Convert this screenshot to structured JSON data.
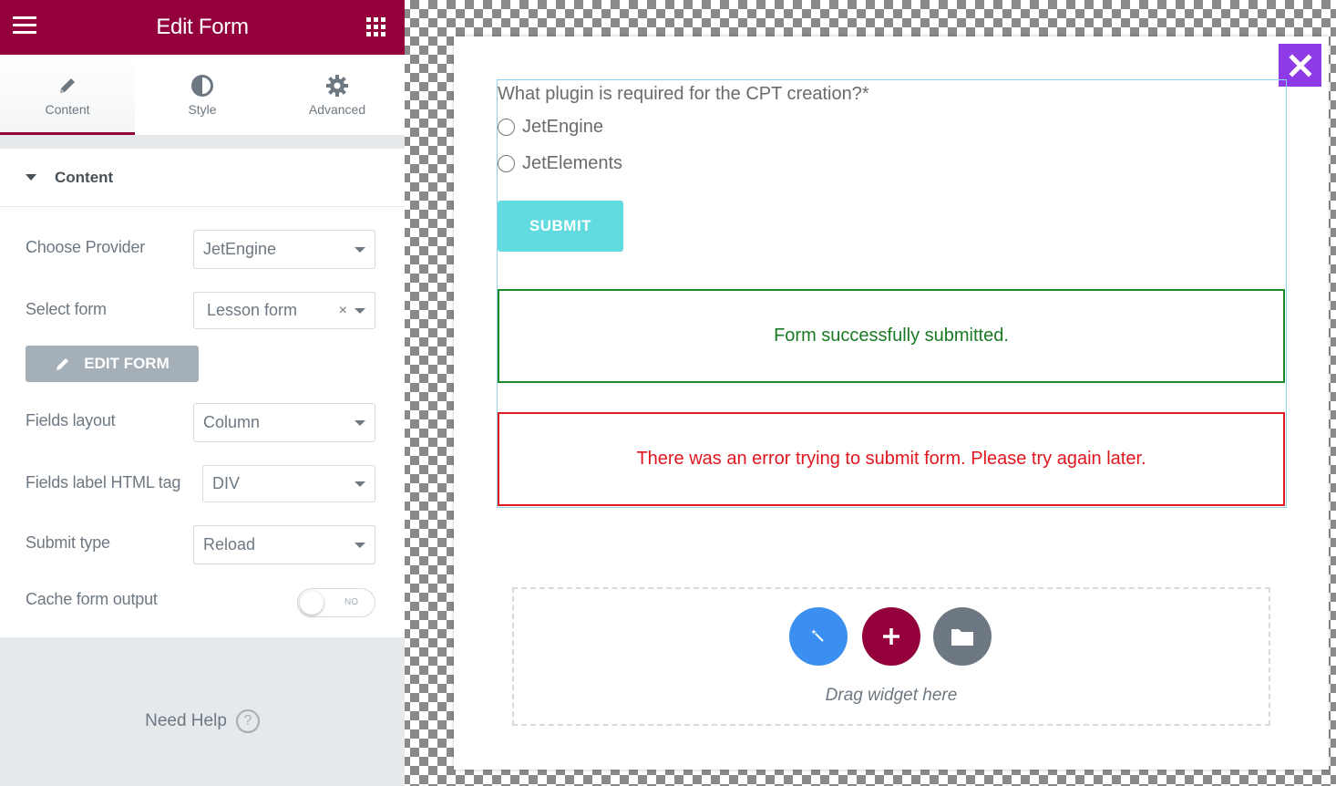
{
  "panel": {
    "title": "Edit Form",
    "tabs": [
      {
        "label": "Content",
        "icon": "pencil-icon"
      },
      {
        "label": "Style",
        "icon": "half-circle-icon"
      },
      {
        "label": "Advanced",
        "icon": "gear-icon"
      }
    ],
    "section_title": "Content",
    "controls": {
      "provider_label": "Choose Provider",
      "provider_value": "JetEngine",
      "select_form_label": "Select form",
      "select_form_value": "Lesson form",
      "edit_form_button": "EDIT FORM",
      "fields_layout_label": "Fields layout",
      "fields_layout_value": "Column",
      "label_tag_label": "Fields label HTML tag",
      "label_tag_value": "DIV",
      "submit_type_label": "Submit type",
      "submit_type_value": "Reload",
      "cache_label": "Cache form output",
      "cache_toggle_text": "NO"
    },
    "need_help": "Need Help",
    "colors": {
      "brand": "#93003c",
      "panel_bg": "#e6e9ec"
    }
  },
  "form": {
    "question": "What plugin is required for the CPT creation?*",
    "options": [
      "JetEngine",
      "JetElements"
    ],
    "submit_label": "SUBMIT",
    "success_message": "Form successfully submitted.",
    "error_message": "There was an error trying to submit form. Please try again later."
  },
  "dropzone": {
    "text": "Drag widget here",
    "buttons": [
      "magic-wand-icon",
      "plus-icon",
      "folder-icon"
    ]
  },
  "modal": {
    "close_icon": "close-icon",
    "close_color": "#8e3ae7"
  }
}
